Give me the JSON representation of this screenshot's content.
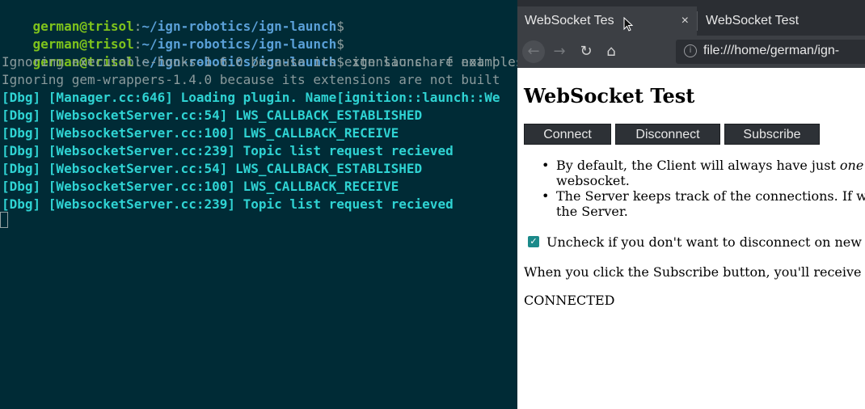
{
  "terminal": {
    "prompt": {
      "user": "german@trisol",
      "separator": ":",
      "path": "~/ign-robotics/ign-launch",
      "dollar": "$"
    },
    "command": " ign launch -f examples/",
    "lines": [
      {
        "text": "Ignoring executable-hooks-1.6.0 because its extensions are not b",
        "style": "grey"
      },
      {
        "text": "Ignoring gem-wrappers-1.4.0 because its extensions are not built",
        "style": "grey"
      },
      {
        "text": "[Dbg] [Manager.cc:646] Loading plugin. Name[ignition::launch::We",
        "style": "cyan"
      },
      {
        "text": "[Dbg] [WebsocketServer.cc:54] LWS_CALLBACK_ESTABLISHED",
        "style": "cyan"
      },
      {
        "text": "[Dbg] [WebsocketServer.cc:100] LWS_CALLBACK_RECEIVE",
        "style": "cyan"
      },
      {
        "text": "[Dbg] [WebsocketServer.cc:239] Topic list request recieved",
        "style": "cyan"
      },
      {
        "text": "[Dbg] [WebsocketServer.cc:54] LWS_CALLBACK_ESTABLISHED",
        "style": "cyan"
      },
      {
        "text": "[Dbg] [WebsocketServer.cc:100] LWS_CALLBACK_RECEIVE",
        "style": "cyan"
      },
      {
        "text": "[Dbg] [WebsocketServer.cc:239] Topic list request recieved",
        "style": "cyan"
      }
    ]
  },
  "browser": {
    "tabs": [
      {
        "label": "WebSocket Tes",
        "close": "×"
      },
      {
        "label": "WebSocket Test",
        "close": ""
      }
    ],
    "nav": {
      "back_icon": "←",
      "forward_icon": "→",
      "reload_icon": "↻",
      "home_icon": "⌂",
      "info_icon": "i",
      "url": "file:///home/german/ign-"
    },
    "page": {
      "heading": "WebSocket Test",
      "buttons": {
        "connect": "Connect",
        "disconnect": "Disconnect",
        "subscribe": "Subscribe"
      },
      "bullet1_pre": "By default, the Client will always have just ",
      "bullet1_em": "one",
      "bullet1_post": " w",
      "bullet1_line2": "websocket.",
      "bullet2_line1": "The Server keeps track of the connections. If w",
      "bullet2_line2": "the Server.",
      "checkbox_label": "Uncheck if you don't want to disconnect on new c",
      "info": "When you click the Subscribe button, you'll receive m",
      "status": "CONNECTED"
    }
  },
  "colors": {
    "terminal_bg": "#002b36",
    "prompt_user": "#7fc31c",
    "prompt_path": "#5aa0d8",
    "debug_text": "#2fd3d3",
    "button_bg": "#2d3136",
    "checkbox": "#1b8a8a"
  }
}
